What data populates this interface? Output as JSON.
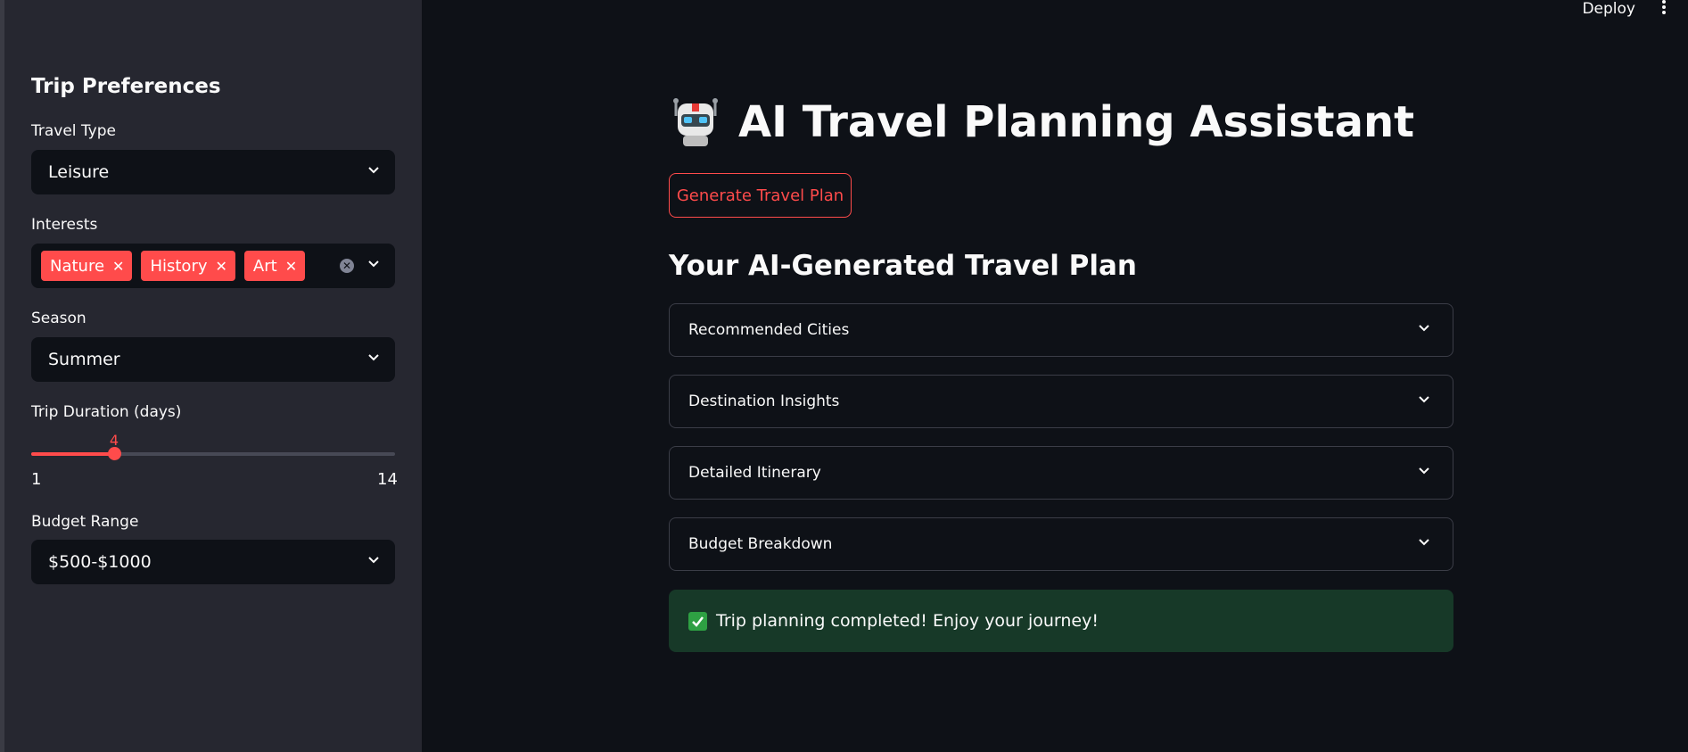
{
  "topbar": {
    "deploy_label": "Deploy",
    "menu_icon": "kebab-menu-icon"
  },
  "sidebar": {
    "title": "Trip Preferences",
    "travel_type": {
      "label": "Travel Type",
      "value": "Leisure"
    },
    "interests": {
      "label": "Interests",
      "tags": [
        "Nature",
        "History",
        "Art"
      ]
    },
    "season": {
      "label": "Season",
      "value": "Summer"
    },
    "duration": {
      "label": "Trip Duration (days)",
      "value": "4",
      "min": "1",
      "max": "14"
    },
    "budget": {
      "label": "Budget Range",
      "value": "$500-$1000"
    }
  },
  "main": {
    "title": "AI Travel Planning Assistant",
    "title_icon": "robot-icon",
    "generate_button": "Generate Travel Plan",
    "section_title": "Your AI-Generated Travel Plan",
    "expanders": [
      "Recommended Cities",
      "Destination Insights",
      "Detailed Itinerary",
      "Budget Breakdown"
    ],
    "success_message": "Trip planning completed! Enjoy your journey!"
  },
  "colors": {
    "accent": "#ff4b4b",
    "background": "#0e1117",
    "sidebar": "#262730",
    "success_bg": "#173928"
  }
}
